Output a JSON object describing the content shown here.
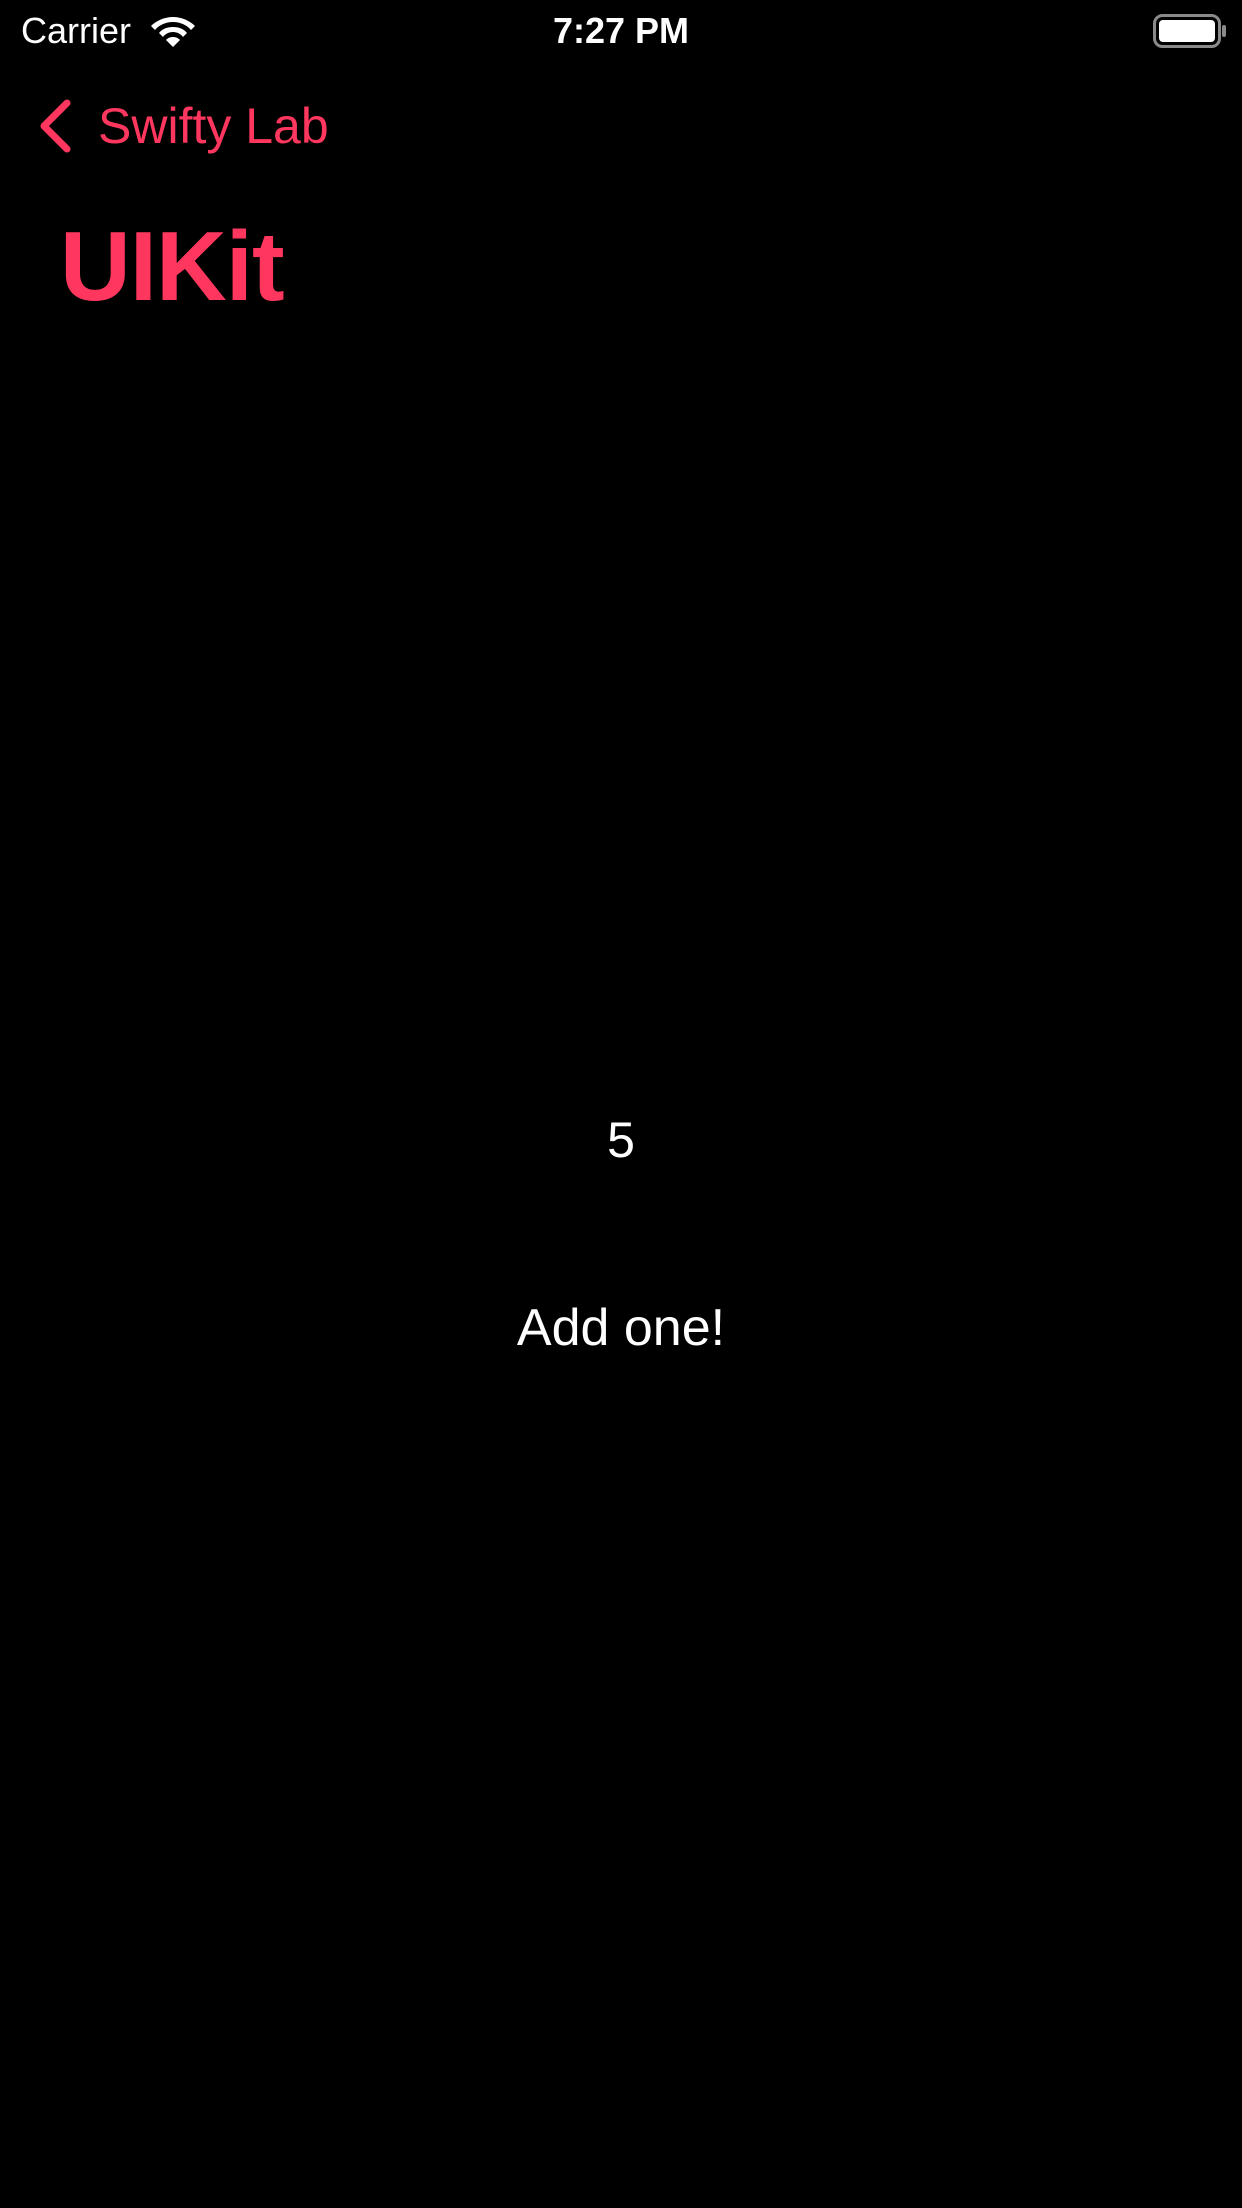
{
  "status_bar": {
    "carrier": "Carrier",
    "time": "7:27 PM",
    "wifi_icon": "wifi-icon",
    "battery_icon": "battery-full-icon"
  },
  "nav": {
    "back_label": "Swifty Lab",
    "back_icon": "chevron-left-icon",
    "title": "UIKit"
  },
  "content": {
    "counter": "5",
    "button_label": "Add one!"
  },
  "colors": {
    "accent": "#FF375F",
    "background": "#000000",
    "text": "#FFFFFF"
  }
}
